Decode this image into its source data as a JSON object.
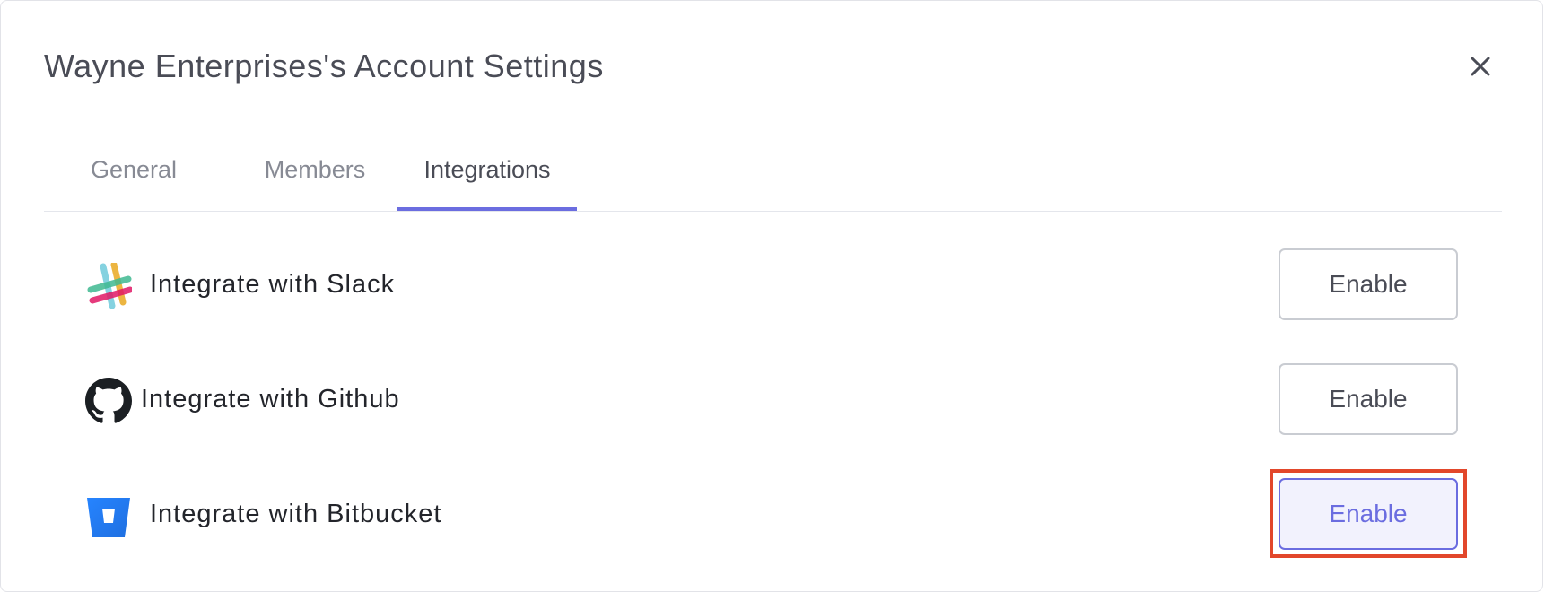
{
  "dialog": {
    "title": "Wayne Enterprises's Account Settings",
    "close_icon": "close-icon"
  },
  "tabs": [
    {
      "label": "General",
      "active": false
    },
    {
      "label": "Members",
      "active": false
    },
    {
      "label": "Integrations",
      "active": true
    }
  ],
  "integrations": [
    {
      "label": "Integrate with Slack",
      "icon": "slack-icon",
      "button_label": "Enable"
    },
    {
      "label": "Integrate with Github",
      "icon": "github-icon",
      "button_label": "Enable"
    },
    {
      "label": "Integrate with Bitbucket",
      "icon": "bitbucket-icon",
      "button_label": "Enable",
      "highlighted": true
    }
  ],
  "colors": {
    "accent": "#6b6de0",
    "highlight_outline": "#e2472b",
    "title_text": "#4a4c56",
    "inactive_tab_text": "#878a94"
  }
}
